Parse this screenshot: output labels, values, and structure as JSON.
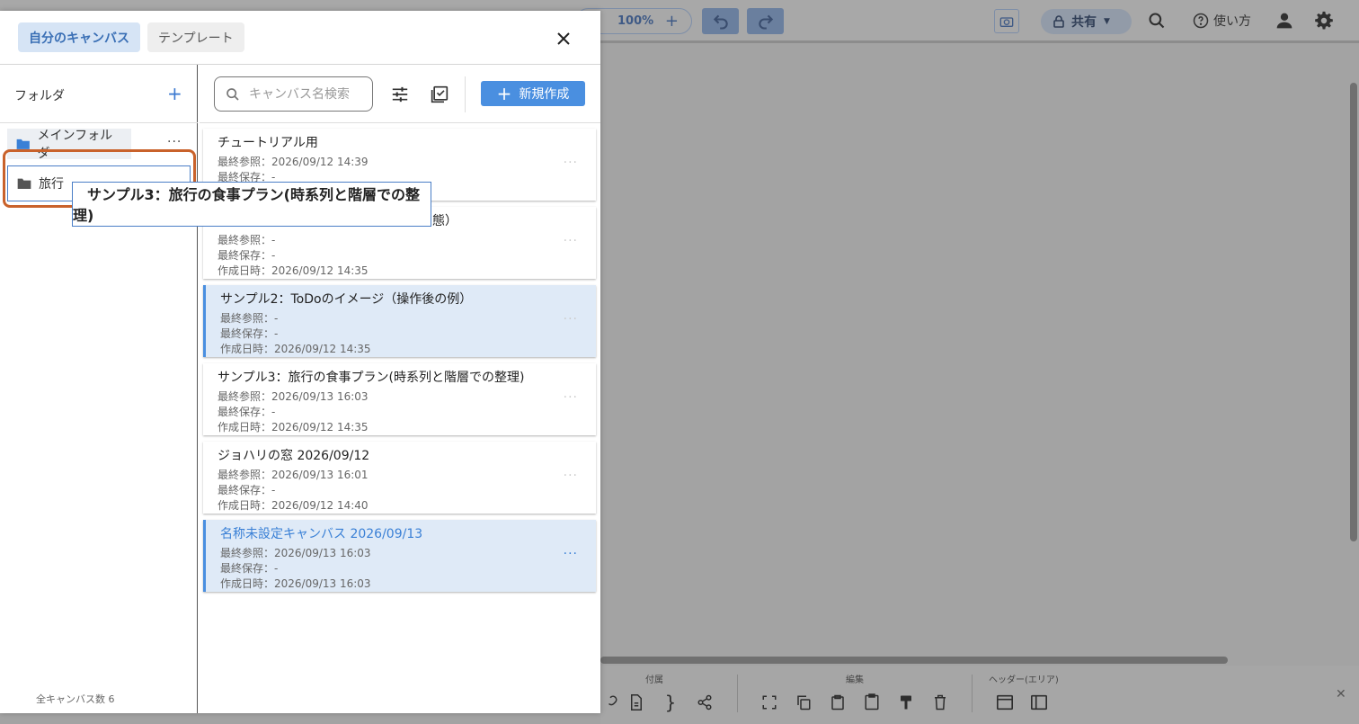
{
  "app_toolbar": {
    "zoom": "100%",
    "share_label": "共有",
    "help_label": "使い方"
  },
  "bottom_toolbar": {
    "group_attach": "付属",
    "group_edit": "編集",
    "group_header": "ヘッダー(エリア)"
  },
  "modal": {
    "tabs": [
      "自分のキャンバス",
      "テンプレート"
    ],
    "sidebar": {
      "title": "フォルダ",
      "folders": [
        "メインフォルダ",
        "旅行"
      ],
      "count_label": "全キャンバス数 6"
    },
    "search_placeholder": "キャンバス名検索",
    "new_button": "新規作成",
    "canvases": [
      {
        "title": "チュートリアル用",
        "last_viewed": "最終参照：2026/09/12 14:39",
        "last_saved": "最終保存：-",
        "created": ""
      },
      {
        "title": "態）",
        "last_viewed": "最終参照：-",
        "last_saved": "最終保存：-",
        "created": "作成日時：2026/09/12 14:35"
      },
      {
        "title": "サンプル2：ToDoのイメージ（操作後の例）",
        "last_viewed": "最終参照：-",
        "last_saved": "最終保存：-",
        "created": "作成日時：2026/09/12 14:35"
      },
      {
        "title": "サンプル3：旅行の食事プラン(時系列と階層での整理)",
        "last_viewed": "最終参照：2026/09/13 16:03",
        "last_saved": "最終保存：-",
        "created": "作成日時：2026/09/12 14:35"
      },
      {
        "title": "ジョハリの窓 2026/09/12",
        "last_viewed": "最終参照：2026/09/13 16:01",
        "last_saved": "最終保存：-",
        "created": "作成日時：2026/09/12 14:40"
      },
      {
        "title": "名称未設定キャンバス 2026/09/13",
        "last_viewed": "最終参照：2026/09/13 16:03",
        "last_saved": "最終保存：-",
        "created": "作成日時：2026/09/13 16:03"
      }
    ],
    "drag_ghost": [
      "サンプル3：旅行の食事プラン(時系列と階層での整",
      "理)"
    ]
  }
}
